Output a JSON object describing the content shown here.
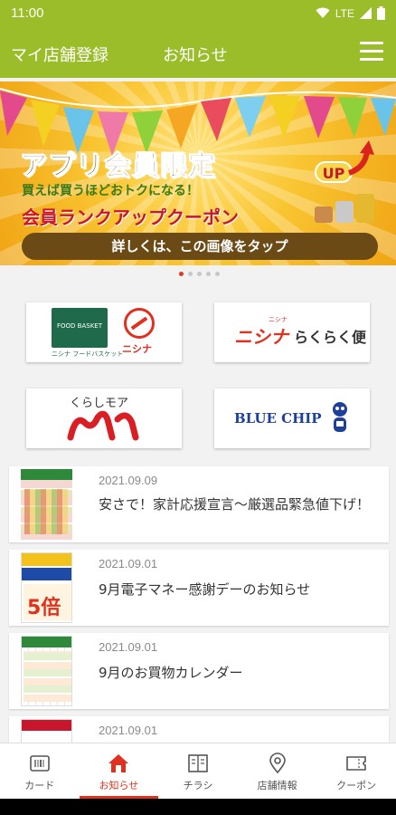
{
  "status_bar": {
    "time": "11:00",
    "network": "LTE"
  },
  "app_bar": {
    "store_register": "マイ店舗登録",
    "title": "お知らせ"
  },
  "banner": {
    "headline": "アプリ会員限定",
    "subline": "買えば買うほどおトクになる！",
    "coupon_title": "会員ランクアップクーポン",
    "up_badge": "UP",
    "cta": "詳しくは、この画像をタップ",
    "page_count": 5,
    "active_page": 0
  },
  "tiles": [
    {
      "id": "foodbasket-nishina",
      "logo_text_1": "FOOD BASKET",
      "logo_text_2": "ニシナ",
      "caption": "ニシナ フードバスケット"
    },
    {
      "id": "nishina-rakuraku",
      "brand": "ニシナ",
      "service": "らくらく便",
      "small": "ニシナ"
    },
    {
      "id": "kurashimore",
      "label": "くらしモア"
    },
    {
      "id": "blue-chip",
      "label": "BLUE CHIP"
    }
  ],
  "news": [
    {
      "date": "2021.09.09",
      "title": "安さで！家計応援宣言〜厳選品緊急値下げ！"
    },
    {
      "date": "2021.09.01",
      "title": "9月電子マネー感謝デーのお知らせ",
      "thumb_text": "5倍"
    },
    {
      "date": "2021.09.01",
      "title": "9月のお買物カレンダー"
    },
    {
      "date": "2021.09.01",
      "title": ""
    }
  ],
  "bottom_nav": [
    {
      "label": "カード",
      "icon": "card-icon"
    },
    {
      "label": "お知らせ",
      "icon": "home-icon",
      "active": true
    },
    {
      "label": "チラシ",
      "icon": "flyer-icon"
    },
    {
      "label": "店舗情報",
      "icon": "location-icon"
    },
    {
      "label": "クーポン",
      "icon": "coupon-icon"
    }
  ],
  "colors": {
    "accent": "#9bbd2a",
    "active": "#e0301e",
    "nishina_red": "#e0301e",
    "blue_chip": "#1f3f9c"
  }
}
